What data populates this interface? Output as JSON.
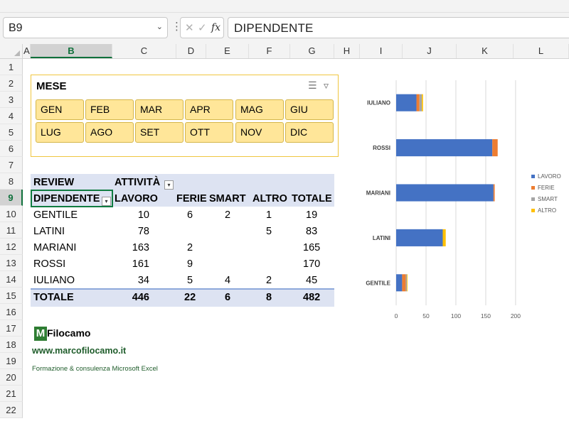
{
  "formula_bar": {
    "name_box": "B9",
    "formula": "DIPENDENTE"
  },
  "columns": [
    "A",
    "B",
    "C",
    "D",
    "E",
    "F",
    "G",
    "H",
    "I",
    "J",
    "K",
    "L"
  ],
  "rows": [
    "1",
    "2",
    "3",
    "4",
    "5",
    "6",
    "7",
    "8",
    "9",
    "10",
    "11",
    "12",
    "13",
    "14",
    "15",
    "16",
    "17",
    "18",
    "19",
    "20",
    "21",
    "22"
  ],
  "slicer": {
    "title": "MESE",
    "buttons": [
      "GEN",
      "FEB",
      "MAR",
      "APR",
      "MAG",
      "GIU",
      "LUG",
      "AGO",
      "SET",
      "OTT",
      "NOV",
      "DIC"
    ]
  },
  "pivot": {
    "corner": "REVIEW",
    "col_field": "ATTIVITÀ",
    "row_field": "DIPENDENTE",
    "col_headers": [
      "LAVORO",
      "FERIE",
      "SMART",
      "ALTRO",
      "TOTALE"
    ],
    "rows": [
      {
        "name": "GENTILE",
        "lavoro": "10",
        "ferie": "6",
        "smart": "2",
        "altro": "1",
        "totale": "19"
      },
      {
        "name": "LATINI",
        "lavoro": "78",
        "ferie": "",
        "smart": "",
        "altro": "5",
        "totale": "83"
      },
      {
        "name": "MARIANI",
        "lavoro": "163",
        "ferie": "2",
        "smart": "",
        "altro": "",
        "totale": "165"
      },
      {
        "name": "ROSSI",
        "lavoro": "161",
        "ferie": "9",
        "smart": "",
        "altro": "",
        "totale": "170"
      },
      {
        "name": "IULIANO",
        "lavoro": "34",
        "ferie": "5",
        "smart": "4",
        "altro": "2",
        "totale": "45"
      }
    ],
    "total": {
      "name": "TOTALE",
      "lavoro": "446",
      "ferie": "22",
      "smart": "6",
      "altro": "8",
      "totale": "482"
    }
  },
  "branding": {
    "logo_letter": "M",
    "logo_text": "Filocamo",
    "url": "www.marcofilocamo.it",
    "tagline": "Formazione & consulenza Microsoft Excel"
  },
  "chart_data": {
    "type": "bar",
    "orientation": "horizontal",
    "stacked": true,
    "categories": [
      "IULIANO",
      "ROSSI",
      "MARIANI",
      "LATINI",
      "GENTILE"
    ],
    "series": [
      {
        "name": "LAVORO",
        "color": "#4472c4",
        "values": [
          34,
          161,
          163,
          78,
          10
        ]
      },
      {
        "name": "FERIE",
        "color": "#ed7d31",
        "values": [
          5,
          9,
          2,
          0,
          6
        ]
      },
      {
        "name": "SMART",
        "color": "#a5a5a5",
        "values": [
          4,
          0,
          0,
          0,
          2
        ]
      },
      {
        "name": "ALTRO",
        "color": "#ffc000",
        "values": [
          2,
          0,
          0,
          5,
          1
        ]
      }
    ],
    "xlim": [
      0,
      200
    ],
    "xticks": [
      "0",
      "50",
      "100",
      "150",
      "200"
    ],
    "legend": "right",
    "grid": true
  }
}
